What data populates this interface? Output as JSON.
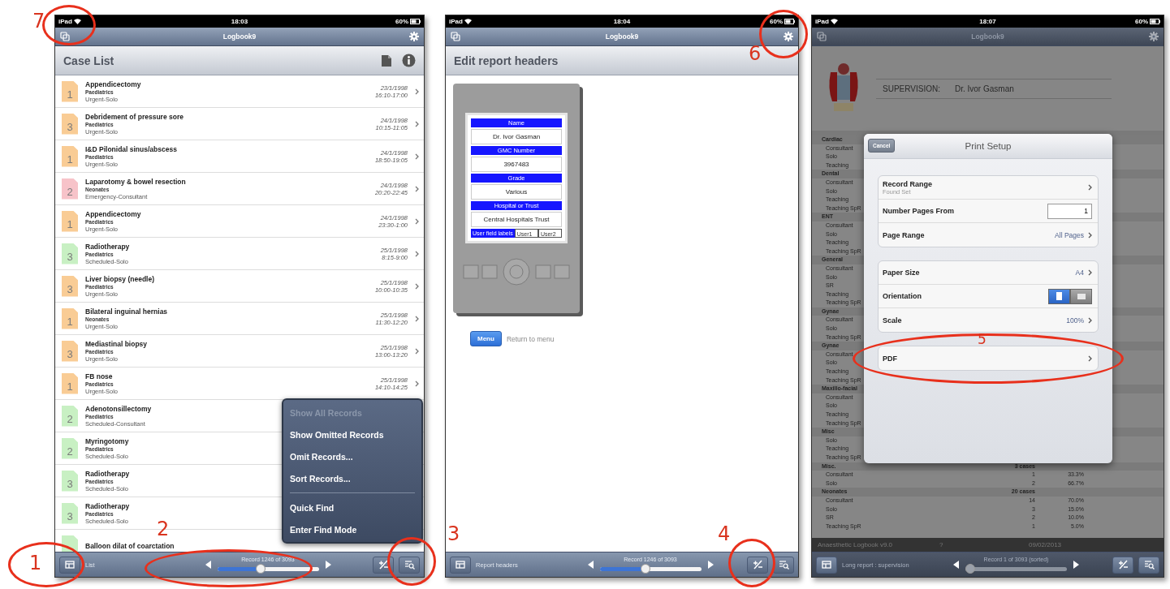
{
  "screens": [
    {
      "kind": "case_list",
      "dimmed": false,
      "status_bar": {
        "device": "iPad",
        "time": "18:03",
        "battery": "60%"
      },
      "title": "Logbook9",
      "header": "Case List",
      "cases": [
        {
          "grade": "1",
          "color": "#f9cc95",
          "title": "Appendicectomy",
          "specialty": "Paediatrics",
          "category": "Urgent-Solo",
          "date": "23/1/1998",
          "time": "16:10-17:00"
        },
        {
          "grade": "3",
          "color": "#f9cc95",
          "title": "Debridement of pressure sore",
          "specialty": "Paediatrics",
          "category": "Urgent-Solo",
          "date": "24/1/1998",
          "time": "10:15-11:05"
        },
        {
          "grade": "1",
          "color": "#f9cc95",
          "title": "I&D Pilonidal sinus/abscess",
          "specialty": "Paediatrics",
          "category": "Urgent-Solo",
          "date": "24/1/1998",
          "time": "18:50-19:05"
        },
        {
          "grade": "2",
          "color": "#f7c3c9",
          "title": "Laparotomy & bowel resection",
          "specialty": "Neonates",
          "category": "Emergency-Consultant",
          "date": "24/1/1998",
          "time": "20:20-22:45"
        },
        {
          "grade": "1",
          "color": "#f9cc95",
          "title": "Appendicectomy",
          "specialty": "Paediatrics",
          "category": "Urgent-Solo",
          "date": "24/1/1998",
          "time": "23:30-1:00"
        },
        {
          "grade": "3",
          "color": "#c8f0c3",
          "title": "Radiotherapy",
          "specialty": "Paediatrics",
          "category": "Scheduled-Solo",
          "date": "25/1/1998",
          "time": "8:15-9:00"
        },
        {
          "grade": "3",
          "color": "#f9cc95",
          "title": "Liver biopsy (needle)",
          "specialty": "Paediatrics",
          "category": "Urgent-Solo",
          "date": "25/1/1998",
          "time": "10:00-10:35"
        },
        {
          "grade": "1",
          "color": "#f9cc95",
          "title": "Bilateral inguinal hernias",
          "specialty": "Neonates",
          "category": "Urgent-Solo",
          "date": "25/1/1998",
          "time": "11:30-12:20"
        },
        {
          "grade": "3",
          "color": "#f9cc95",
          "title": "Mediastinal biopsy",
          "specialty": "Paediatrics",
          "category": "Urgent-Solo",
          "date": "25/1/1998",
          "time": "13:00-13:20"
        },
        {
          "grade": "1",
          "color": "#f9cc95",
          "title": "FB nose",
          "specialty": "Paediatrics",
          "category": "Urgent-Solo",
          "date": "25/1/1998",
          "time": "14:10-14:25"
        },
        {
          "grade": "2",
          "color": "#c8f0c3",
          "title": "Adenotonsillectomy",
          "specialty": "Paediatrics",
          "category": "Scheduled-Consultant"
        },
        {
          "grade": "2",
          "color": "#c8f0c3",
          "title": "Myringotomy",
          "specialty": "Paediatrics",
          "category": "Scheduled-Solo"
        },
        {
          "grade": "3",
          "color": "#c8f0c3",
          "title": "Radiotherapy",
          "specialty": "Paediatrics",
          "category": "Scheduled-Solo"
        },
        {
          "grade": "3",
          "color": "#c8f0c3",
          "title": "Radiotherapy",
          "specialty": "Paediatrics",
          "category": "Scheduled-Solo"
        },
        {
          "color": "#c8f0c3",
          "title": "Balloon dilat of coarctation"
        }
      ],
      "menu_groups": [
        [
          {
            "label": "Show All Records",
            "disabled": true
          },
          {
            "label": "Show Omitted Records",
            "disabled": false
          },
          {
            "label": "Omit Records...",
            "disabled": false
          },
          {
            "label": "Sort Records...",
            "disabled": false
          }
        ],
        [
          {
            "label": "Quick Find",
            "disabled": false
          },
          {
            "label": "Enter Find Mode",
            "disabled": false
          }
        ]
      ],
      "toolbar": {
        "layout": "List",
        "record": "Record 1246 of 3093",
        "level": 0.42
      }
    },
    {
      "kind": "report_headers",
      "dimmed": false,
      "status_bar": {
        "device": "iPad",
        "time": "18:04",
        "battery": "60%"
      },
      "title": "Logbook9",
      "header": "Edit report headers",
      "card": {
        "fields": [
          {
            "label": "Name",
            "value": "Dr. Ivor Gasman"
          },
          {
            "label": "GMC Number",
            "value": "3967483"
          },
          {
            "label": "Grade",
            "value": "Various"
          },
          {
            "label": "Hospital or Trust",
            "value": "Central Hospitals Trust"
          }
        ],
        "user_label": "User field labels",
        "user_fields": [
          "User1",
          "User2"
        ]
      },
      "menu_button": "Menu",
      "menu_hint": "Return to menu",
      "toolbar": {
        "layout": "Report headers",
        "record": "Record 1246 of 3093",
        "level": 0.45
      }
    },
    {
      "kind": "print_setup",
      "dimmed": true,
      "status_bar": {
        "device": "iPad",
        "time": "18:07",
        "battery": "60%"
      },
      "title": "Logbook9",
      "report": {
        "heading": "SUPERVISION:",
        "name": "Dr. Ivor Gasman",
        "sections": [
          {
            "name": "Cardiac",
            "rows": [
              {
                "label": "Consultant"
              },
              {
                "label": "Solo"
              },
              {
                "label": "Teaching"
              }
            ]
          },
          {
            "name": "Dental",
            "rows": [
              {
                "label": "Consultant"
              },
              {
                "label": "Solo"
              },
              {
                "label": "Teaching"
              },
              {
                "label": "Teaching SpR"
              }
            ]
          },
          {
            "name": "ENT",
            "rows": [
              {
                "label": "Consultant"
              },
              {
                "label": "Solo"
              },
              {
                "label": "Teaching"
              },
              {
                "label": "Teaching SpR"
              }
            ]
          },
          {
            "name": "General",
            "rows": [
              {
                "label": "Consultant"
              },
              {
                "label": "Solo"
              },
              {
                "label": "SR"
              },
              {
                "label": "Teaching"
              },
              {
                "label": "Teaching SpR"
              }
            ]
          },
          {
            "name": "Gynae",
            "rows": [
              {
                "label": "Consultant"
              },
              {
                "label": "Solo"
              },
              {
                "label": "Teaching SpR"
              }
            ]
          },
          {
            "name": "Gynae",
            "rows": [
              {
                "label": "Consultant"
              },
              {
                "label": "Solo"
              },
              {
                "label": "Teaching"
              },
              {
                "label": "Teaching SpR"
              }
            ]
          },
          {
            "name": "Maxillo-facial",
            "rows": [
              {
                "label": "Consultant"
              },
              {
                "label": "Solo"
              },
              {
                "label": "Teaching"
              },
              {
                "label": "Teaching SpR"
              }
            ]
          },
          {
            "name": "Misc",
            "rows": [
              {
                "label": "Solo"
              },
              {
                "label": "Teaching"
              },
              {
                "label": "Teaching SpR"
              }
            ]
          },
          {
            "name": "Misc.",
            "count": "3 cases",
            "rows": [
              {
                "label": "Consultant",
                "n": "1",
                "pct": "33.3%"
              },
              {
                "label": "Solo",
                "n": "2",
                "pct": "66.7%"
              }
            ]
          },
          {
            "name": "Neonates",
            "count": "20 cases",
            "rows": [
              {
                "label": "Consultant",
                "n": "14",
                "pct": "70.0%"
              },
              {
                "label": "Solo",
                "n": "3",
                "pct": "15.0%"
              },
              {
                "label": "SR",
                "n": "2",
                "pct": "10.0%"
              },
              {
                "label": "Teaching SpR",
                "n": "1",
                "pct": "5.0%"
              }
            ]
          }
        ],
        "footer": {
          "title": "Anaesthetic Logbook v9.0",
          "page": "?",
          "date": "09/02/2013"
        }
      },
      "dialog": {
        "cancel": "Cancel",
        "title": "Print Setup",
        "groups": [
          [
            {
              "kind": "link",
              "label": "Record Range",
              "detail": "Found Set"
            },
            {
              "kind": "input",
              "label": "Number Pages From",
              "value": "1"
            },
            {
              "kind": "link",
              "label": "Page Range",
              "value": "All Pages"
            }
          ],
          [
            {
              "kind": "link",
              "label": "Paper Size",
              "value": "A4"
            },
            {
              "kind": "segmented",
              "label": "Orientation",
              "options": [
                {
                  "kind": "portrait",
                  "selected": true
                },
                {
                  "kind": "landscape",
                  "selected": false
                }
              ]
            },
            {
              "kind": "link",
              "label": "Scale",
              "value": "100%"
            }
          ],
          [
            {
              "kind": "link",
              "label": "PDF"
            }
          ]
        ]
      },
      "toolbar": {
        "layout": "Long report : supervision",
        "record": "Record 1 of 3093 (sorted)",
        "level": 0
      }
    }
  ],
  "annotations": [
    {
      "label": "1",
      "ring": true
    },
    {
      "label": "2",
      "ring": true
    },
    {
      "ring": true
    },
    {
      "label": "3",
      "ring": false
    },
    {
      "label": "4",
      "ring": true
    },
    {
      "label": "5",
      "ring": true
    },
    {
      "label": "6",
      "ring": true
    },
    {
      "label": "7",
      "ring": true
    }
  ]
}
